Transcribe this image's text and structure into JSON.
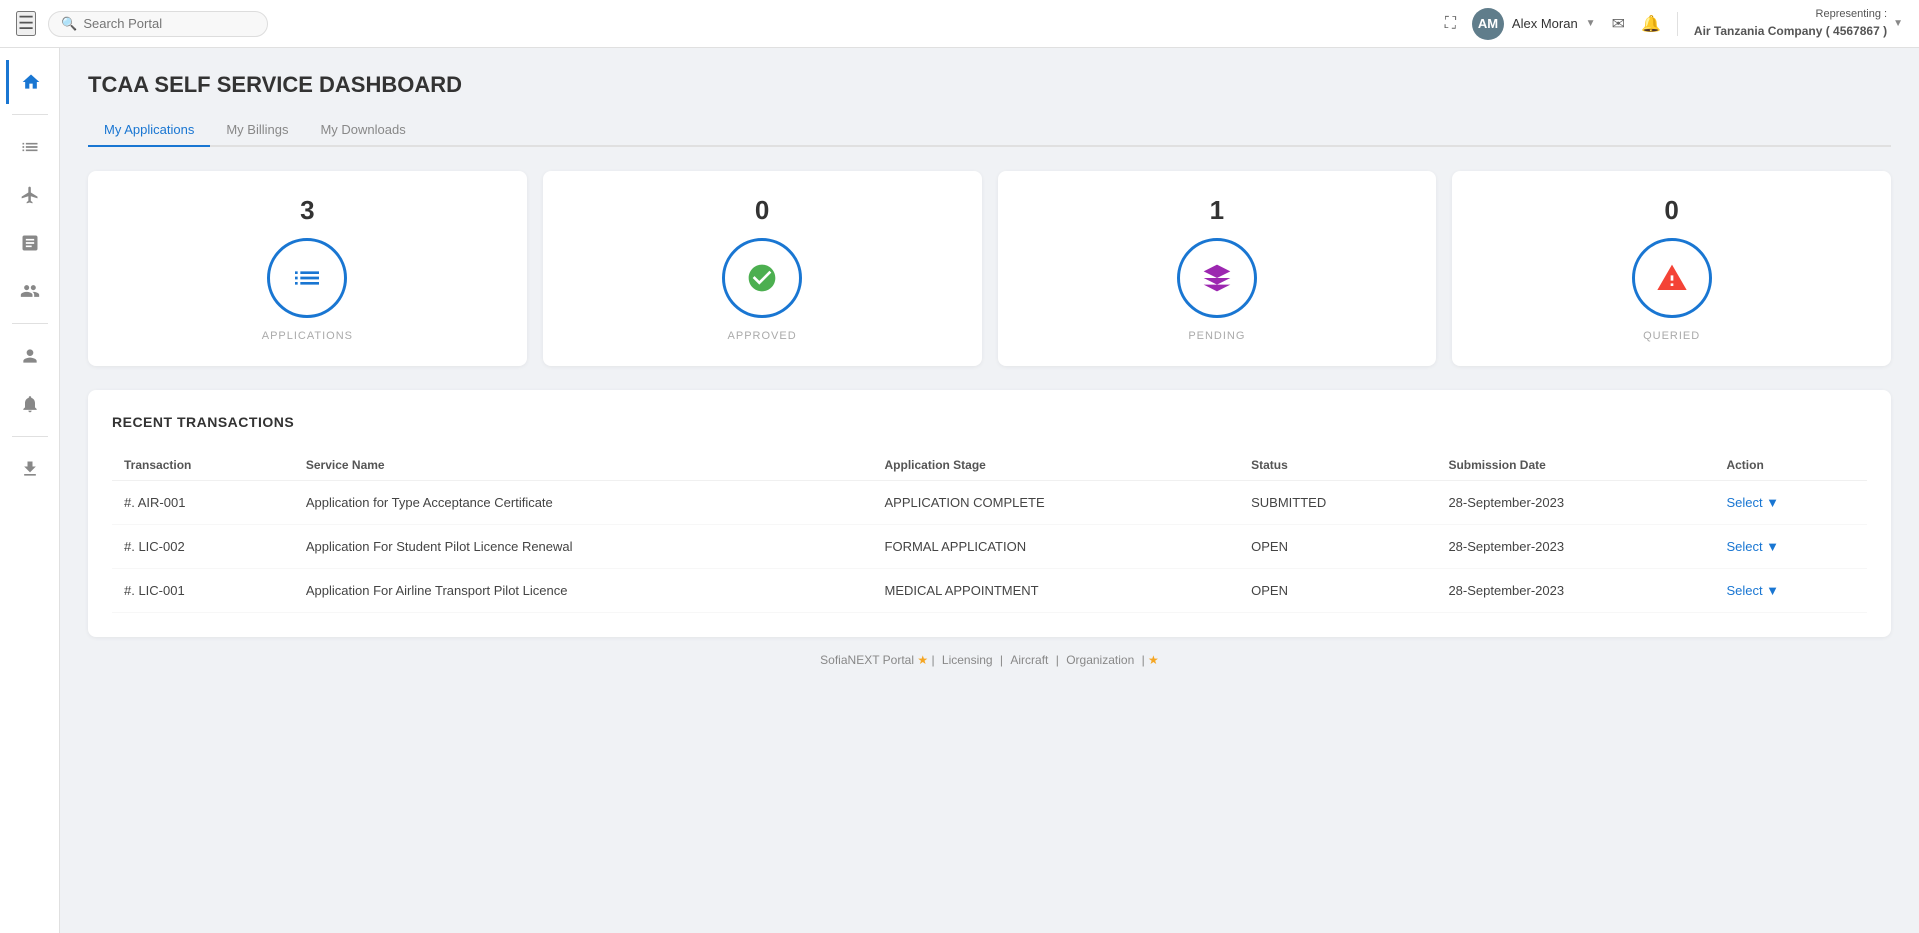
{
  "header": {
    "search_placeholder": "Search Portal",
    "user_name": "Alex Moran",
    "user_initials": "AM",
    "representing_label": "Representing :",
    "representing_company": "Air Tanzania Company ( 4567867 )"
  },
  "sidebar": {
    "items": [
      {
        "id": "home",
        "icon": "home-icon",
        "active": true
      },
      {
        "id": "list",
        "icon": "list-icon",
        "active": false
      },
      {
        "id": "plus",
        "icon": "plus-icon",
        "active": false
      },
      {
        "id": "form",
        "icon": "form-icon",
        "active": false
      },
      {
        "id": "people",
        "icon": "people-icon",
        "active": false
      },
      {
        "id": "person",
        "icon": "person-icon",
        "active": false
      },
      {
        "id": "bell",
        "icon": "bell-icon",
        "active": false
      },
      {
        "id": "download2",
        "icon": "download2-icon",
        "active": false
      }
    ]
  },
  "page": {
    "title": "TCAA SELF SERVICE DASHBOARD",
    "tabs": [
      {
        "label": "My Applications",
        "active": true
      },
      {
        "label": "My Billings",
        "active": false
      },
      {
        "label": "My Downloads",
        "active": false
      }
    ]
  },
  "stats": [
    {
      "value": "3",
      "label": "APPLICATIONS",
      "icon": "list-icon",
      "icon_char": "≡",
      "color": "#1976d2"
    },
    {
      "value": "0",
      "label": "APPROVED",
      "icon": "check-icon",
      "icon_char": "✓",
      "color": "#4caf50"
    },
    {
      "value": "1",
      "label": "PENDING",
      "icon": "pending-icon",
      "icon_char": "◈",
      "color": "#9c27b0"
    },
    {
      "value": "0",
      "label": "QUERIED",
      "icon": "warning-icon",
      "icon_char": "⚠",
      "color": "#f44336"
    }
  ],
  "transactions": {
    "section_title": "RECENT TRANSACTIONS",
    "columns": {
      "transaction": "Transaction",
      "service_name": "Service Name",
      "application_stage": "Application Stage",
      "status": "Status",
      "submission_date": "Submission Date",
      "action": "Action"
    },
    "rows": [
      {
        "transaction": "#. AIR-001",
        "service_name": "Application for Type Acceptance Certificate",
        "application_stage": "APPLICATION COMPLETE",
        "stage_class": "stage-complete",
        "status": "SUBMITTED",
        "status_class": "status-submitted",
        "submission_date": "28-September-2023",
        "action": "Select"
      },
      {
        "transaction": "#. LIC-002",
        "service_name": "Application For Student Pilot Licence Renewal",
        "application_stage": "FORMAL APPLICATION",
        "stage_class": "stage-formal",
        "status": "OPEN",
        "status_class": "status-open",
        "submission_date": "28-September-2023",
        "action": "Select"
      },
      {
        "transaction": "#. LIC-001",
        "service_name": "Application For Airline Transport Pilot Licence",
        "application_stage": "MEDICAL APPOINTMENT",
        "stage_class": "stage-medical",
        "status": "OPEN",
        "status_class": "status-open",
        "submission_date": "28-September-2023",
        "action": "Select"
      }
    ]
  },
  "footer": {
    "text": "SofiaNEXT Portal",
    "links": [
      "Licensing",
      "Aircraft",
      "Organization"
    ]
  },
  "colors": {
    "primary": "#1976d2",
    "success": "#4caf50",
    "warning": "#f57c00",
    "danger": "#f44336",
    "purple": "#9c27b0"
  }
}
